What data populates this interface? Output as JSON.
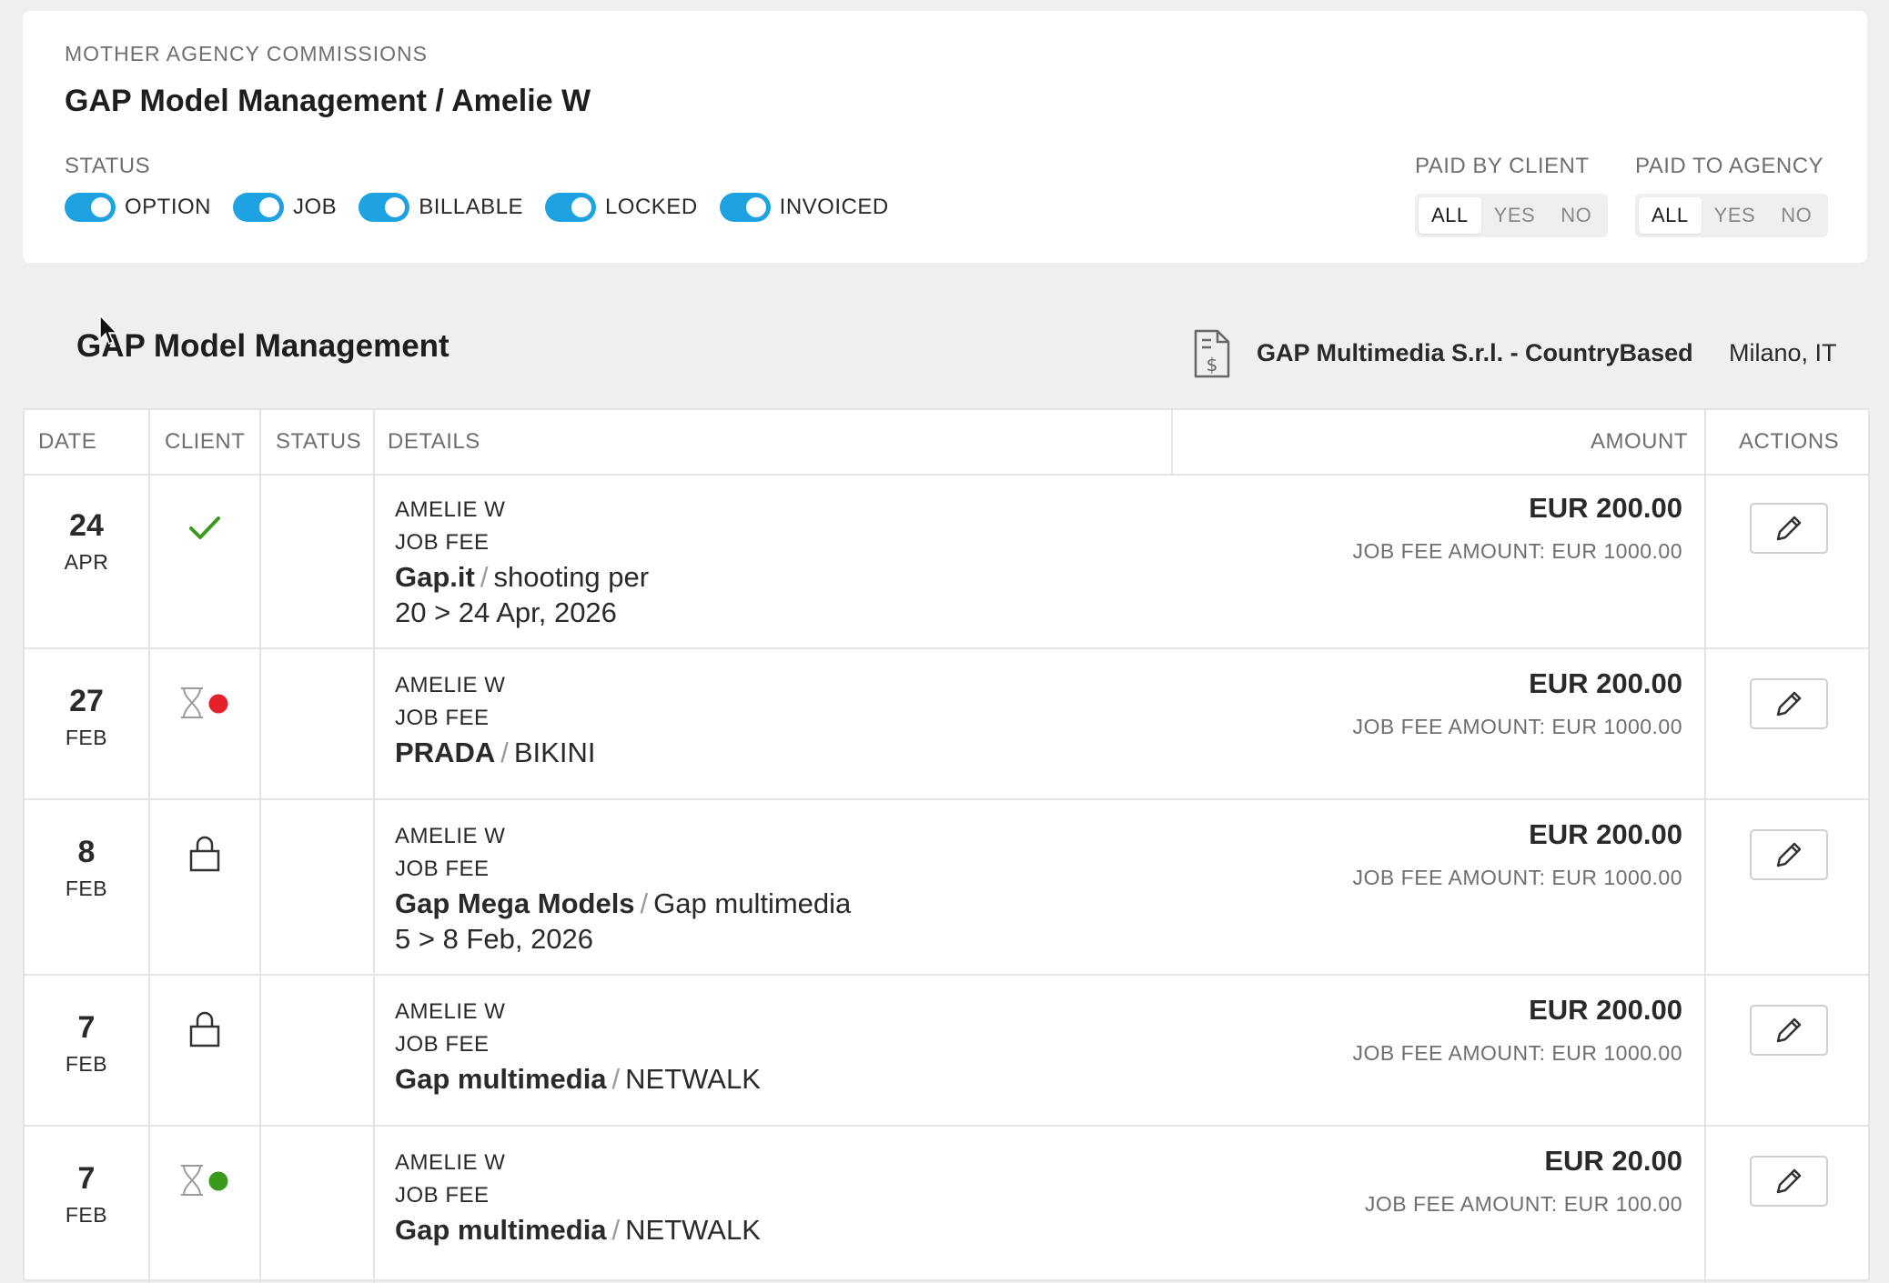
{
  "panel": {
    "kicker": "MOTHER AGENCY COMMISSIONS",
    "title": "GAP Model Management / Amelie W",
    "status_label": "STATUS",
    "toggles": [
      {
        "label": "OPTION",
        "on": true
      },
      {
        "label": "JOB",
        "on": true
      },
      {
        "label": "BILLABLE",
        "on": true
      },
      {
        "label": "LOCKED",
        "on": true
      },
      {
        "label": "INVOICED",
        "on": true
      }
    ],
    "paid_by_client": {
      "label": "PAID BY CLIENT",
      "options": [
        "ALL",
        "YES",
        "NO"
      ],
      "selected": "ALL"
    },
    "paid_to_agency": {
      "label": "PAID TO AGENCY",
      "options": [
        "ALL",
        "YES",
        "NO"
      ],
      "selected": "ALL"
    }
  },
  "agency": {
    "name": "GAP Model Management",
    "company": "GAP Multimedia S.r.l. - CountryBased",
    "city": "Milano, IT",
    "icon": "invoice-dollar-icon"
  },
  "table": {
    "headers": {
      "date": "DATE",
      "client": "CLIENT",
      "status": "STATUS",
      "details": "DETAILS",
      "amount": "AMOUNT",
      "actions": "ACTIONS"
    },
    "rows": [
      {
        "day": "24",
        "month": "APR",
        "client_icon": "check-icon",
        "model": "AMELIE W",
        "type": "JOB FEE",
        "client": "Gap.it",
        "separator": "/",
        "description": "shooting per",
        "dates": "20 > 24 Apr, 2026",
        "amount": "EUR 200.00",
        "sub": "JOB FEE AMOUNT: EUR 1000.00"
      },
      {
        "day": "27",
        "month": "FEB",
        "client_icon": "hourglass-red-dot-icon",
        "model": "AMELIE W",
        "type": "JOB FEE",
        "client": "PRADA",
        "separator": "/",
        "description": "BIKINI",
        "dates": "",
        "amount": "EUR 200.00",
        "sub": "JOB FEE AMOUNT: EUR 1000.00"
      },
      {
        "day": "8",
        "month": "FEB",
        "client_icon": "lock-icon",
        "model": "AMELIE W",
        "type": "JOB FEE",
        "client": "Gap Mega Models",
        "separator": "/",
        "description": "Gap multimedia",
        "dates": "5 > 8 Feb, 2026",
        "amount": "EUR 200.00",
        "sub": "JOB FEE AMOUNT: EUR 1000.00"
      },
      {
        "day": "7",
        "month": "FEB",
        "client_icon": "lock-icon",
        "model": "AMELIE W",
        "type": "JOB FEE",
        "client": "Gap multimedia",
        "separator": "/",
        "description": "NETWALK",
        "dates": "",
        "amount": "EUR 200.00",
        "sub": "JOB FEE AMOUNT: EUR 1000.00"
      },
      {
        "day": "7",
        "month": "FEB",
        "client_icon": "hourglass-green-dot-icon",
        "model": "AMELIE W",
        "type": "JOB FEE",
        "client": "Gap multimedia",
        "separator": "/",
        "description": "NETWALK",
        "dates": "",
        "amount": "EUR 20.00",
        "sub": "JOB FEE AMOUNT: EUR 100.00"
      }
    ]
  },
  "colors": {
    "toggle": "#1fa2e2",
    "check": "#3a9a1e",
    "red_dot": "#e5222b",
    "green_dot": "#3a9a1e"
  }
}
